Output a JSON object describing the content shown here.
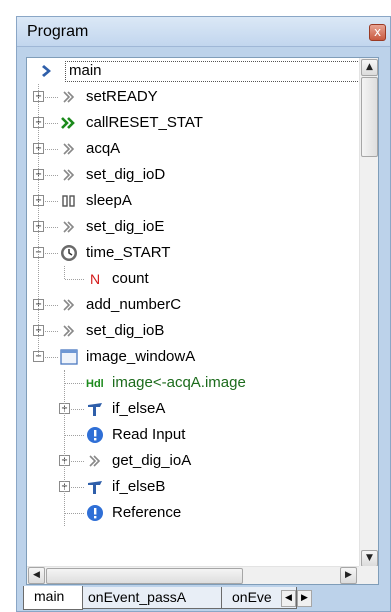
{
  "panel": {
    "title": "Program",
    "close_glyph": "x"
  },
  "tree": {
    "root": {
      "label": "main",
      "icon": "blue-chevron-icon"
    },
    "items": [
      {
        "label": "setREADY",
        "icon": "step-icon",
        "expander": "+"
      },
      {
        "label": "callRESET_STAT",
        "icon": "double-green-chevron-icon",
        "expander": "+"
      },
      {
        "label": "acqA",
        "icon": "step-icon",
        "expander": "+"
      },
      {
        "label": "set_dig_ioD",
        "icon": "step-icon",
        "expander": "+"
      },
      {
        "label": "sleepA",
        "icon": "pause-icon",
        "expander": "+"
      },
      {
        "label": "set_dig_ioE",
        "icon": "step-icon",
        "expander": "+"
      },
      {
        "label": "time_START",
        "icon": "clock-icon",
        "expander": "−"
      },
      {
        "label": "count",
        "icon": "n-icon",
        "glyph": "N"
      },
      {
        "label": "add_numberC",
        "icon": "step-icon",
        "expander": "+"
      },
      {
        "label": "set_dig_ioB",
        "icon": "step-icon",
        "expander": "+"
      },
      {
        "label": "image_windowA",
        "icon": "window-icon",
        "expander": "−"
      },
      {
        "label": "image<-acqA.image",
        "icon": "hdl-icon",
        "glyph": "Hdl"
      },
      {
        "label": "if_elseA",
        "icon": "branch-icon",
        "expander": "+"
      },
      {
        "label": "Read Input",
        "icon": "info-icon",
        "glyph": "!"
      },
      {
        "label": "get_dig_ioA",
        "icon": "step-icon",
        "expander": "+"
      },
      {
        "label": "if_elseB",
        "icon": "branch-icon",
        "expander": "+"
      },
      {
        "label": "Reference",
        "icon": "info-icon",
        "glyph": "!"
      }
    ]
  },
  "scrollbars": {
    "up": "▲",
    "down": "▼",
    "left": "◀",
    "right": "▶"
  },
  "tabs": [
    {
      "label": "main",
      "active": true
    },
    {
      "label": "onEvent_passA",
      "active": false
    },
    {
      "label": "onEve",
      "active": false
    }
  ],
  "colors": {
    "accent_blue": "#2f5faa",
    "green": "#1c8a1c",
    "frame": "#bcd2ea"
  }
}
